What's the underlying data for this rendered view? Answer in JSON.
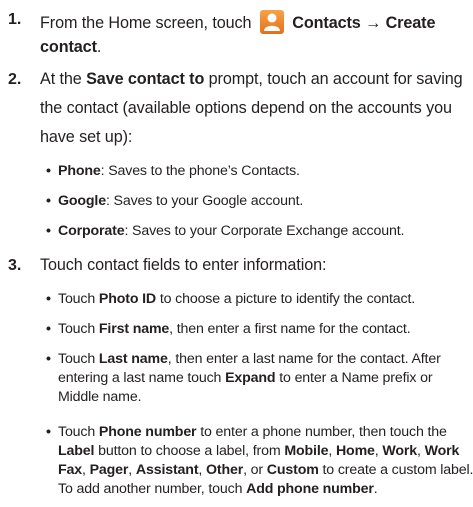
{
  "steps": [
    {
      "number": "1.",
      "line1_pre": "From the Home screen, touch ",
      "line1_bold": "Contacts → Create",
      "line2_bold": "contact",
      "line2_post": "."
    },
    {
      "number": "2.",
      "line1_pre": "At the ",
      "line1_bold": "Save contact to",
      "line1_post": " prompt, touch an account for saving",
      "line2": "the contact (available options depend on the accounts you",
      "line3": "have set up):",
      "bullets": [
        {
          "bold": "Phone",
          "text": ": Saves to the phone’s Contacts."
        },
        {
          "bold": "Google",
          "text": ": Saves to your Google account."
        },
        {
          "bold": "Corporate",
          "text": ": Saves to your Corporate Exchange account."
        }
      ]
    },
    {
      "number": "3.",
      "line1": "Touch contact fields to enter information:",
      "b1": {
        "pre": "Touch ",
        "bold": "Photo ID",
        "post": " to choose a picture to identify the contact."
      },
      "b2": {
        "pre": "Touch ",
        "bold": "First name",
        "post": ", then enter a first name for the contact."
      },
      "b3": {
        "pre": "Touch ",
        "bold": "Last name",
        "post": ", then enter a last name for the contact. After",
        "c1_pre": "entering a last name touch ",
        "c1_bold": "Expand",
        "c1_post": " to enter a Name prefix or",
        "c2": "Middle name."
      },
      "b4": {
        "pre": "Touch ",
        "bold": "Phone number",
        "post": " to enter a phone number, then touch the",
        "c1_b1": "Label",
        "c1_t1": " button to choose a label, from ",
        "c1_b2": "Mobile",
        "c1_t2": ", ",
        "c1_b3": "Home",
        "c1_t3": ", ",
        "c1_b4": "Work",
        "c1_t4": ", ",
        "c1_b5": "Work",
        "c2_b1": "Fax",
        "c2_t1": ", ",
        "c2_b2": "Pager",
        "c2_t2": ", ",
        "c2_b3": "Assistant",
        "c2_t3": ", ",
        "c2_b4": "Other",
        "c2_t4": ", or ",
        "c2_b5": "Custom",
        "c2_t5": " to create a custom label.",
        "c3_pre": "To add another number, touch ",
        "c3_bold": "Add phone number",
        "c3_post": "."
      }
    }
  ],
  "bullet_char": "•",
  "icon": "contacts-app-icon"
}
